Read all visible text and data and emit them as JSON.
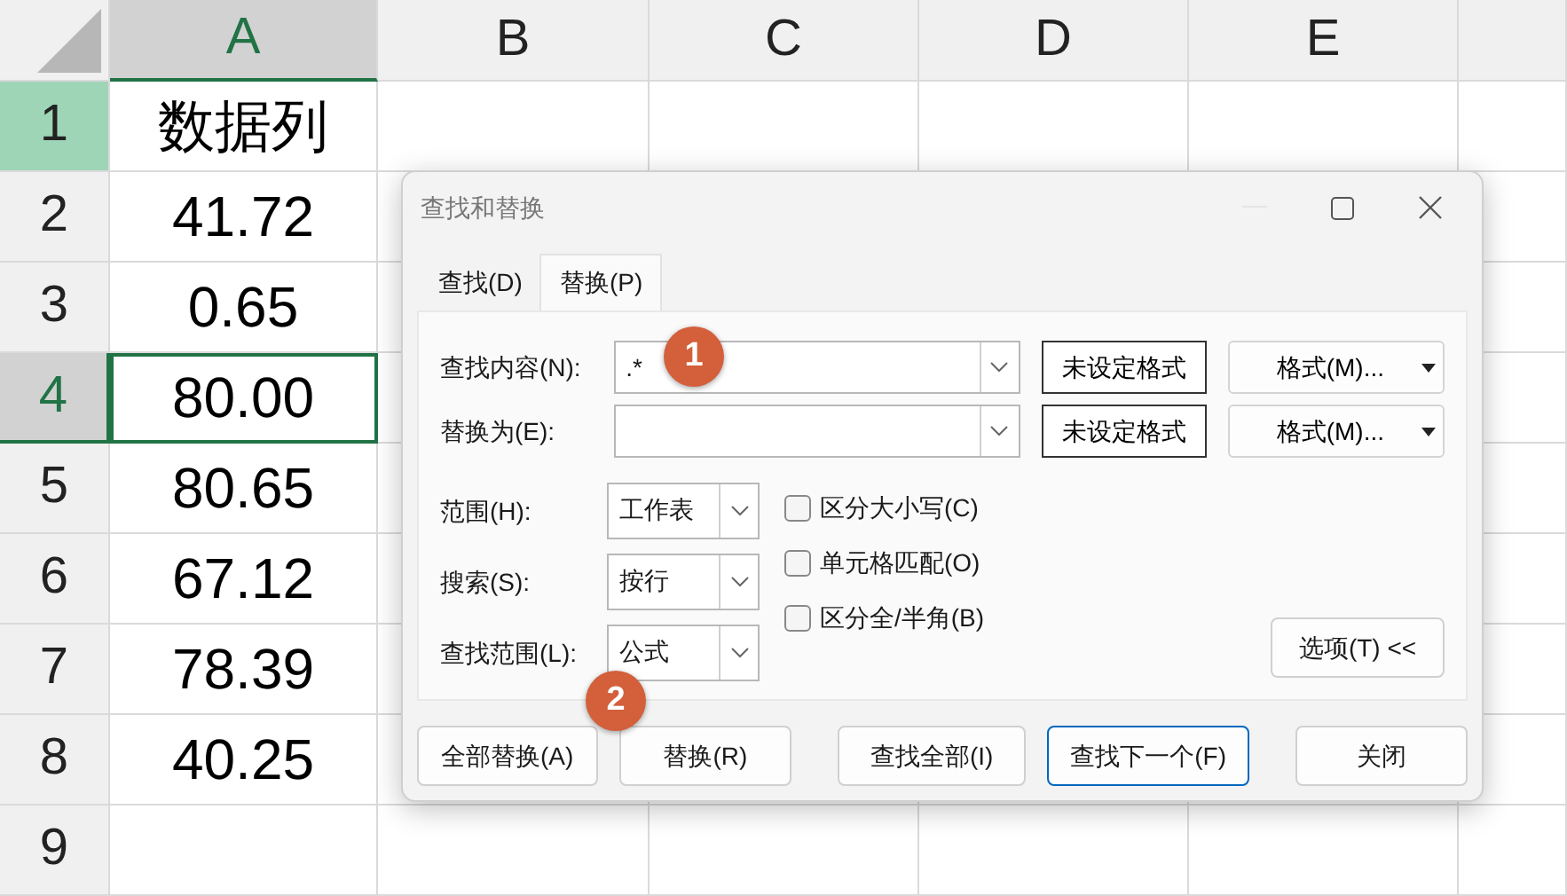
{
  "sheet": {
    "columns": [
      {
        "label": "A",
        "selected": true
      },
      {
        "label": "B",
        "selected": false
      },
      {
        "label": "C",
        "selected": false
      },
      {
        "label": "D",
        "selected": false
      },
      {
        "label": "E",
        "selected": false
      }
    ],
    "rows": [
      {
        "label": "1",
        "highlighted": true,
        "selected": false,
        "value": "数据列"
      },
      {
        "label": "2",
        "highlighted": false,
        "selected": false,
        "value": "41.72"
      },
      {
        "label": "3",
        "highlighted": false,
        "selected": false,
        "value": "0.65"
      },
      {
        "label": "4",
        "highlighted": false,
        "selected": true,
        "value": "80.00"
      },
      {
        "label": "5",
        "highlighted": false,
        "selected": false,
        "value": "80.65"
      },
      {
        "label": "6",
        "highlighted": false,
        "selected": false,
        "value": "67.12"
      },
      {
        "label": "7",
        "highlighted": false,
        "selected": false,
        "value": "78.39"
      },
      {
        "label": "8",
        "highlighted": false,
        "selected": false,
        "value": "40.25"
      },
      {
        "label": "9",
        "highlighted": false,
        "selected": false,
        "value": ""
      }
    ]
  },
  "dialog": {
    "title": "查找和替换",
    "tabs": [
      {
        "label": "查找(D)",
        "selected": false
      },
      {
        "label": "替换(P)",
        "selected": true
      }
    ],
    "fields": [
      {
        "label": "查找内容(N):",
        "value": ".*",
        "format_status": "未设定格式",
        "format_button": "格式(M)..."
      },
      {
        "label": "替换为(E):",
        "format_status": "未设定格式",
        "format_button": "格式(M)..."
      }
    ],
    "options": [
      {
        "label": "范围(H):",
        "value": "工作表"
      },
      {
        "label": "搜索(S):",
        "value": "按行"
      },
      {
        "label": "查找范围(L):",
        "value": "公式"
      }
    ],
    "checkboxes": [
      {
        "label": "区分大小写(C)",
        "checked": false
      },
      {
        "label": "单元格匹配(O)",
        "checked": false
      },
      {
        "label": "区分全/半角(B)",
        "checked": false
      }
    ],
    "options_button": "选项(T) <<",
    "buttons": [
      {
        "label": "全部替换(A)",
        "default": false
      },
      {
        "label": "替换(R)",
        "default": false
      },
      {
        "label": "查找全部(I)",
        "default": false
      },
      {
        "label": "查找下一个(F)",
        "default": true
      },
      {
        "label": "关闭",
        "default": false
      }
    ]
  },
  "annotations": [
    {
      "label": "1"
    },
    {
      "label": "2"
    }
  ]
}
